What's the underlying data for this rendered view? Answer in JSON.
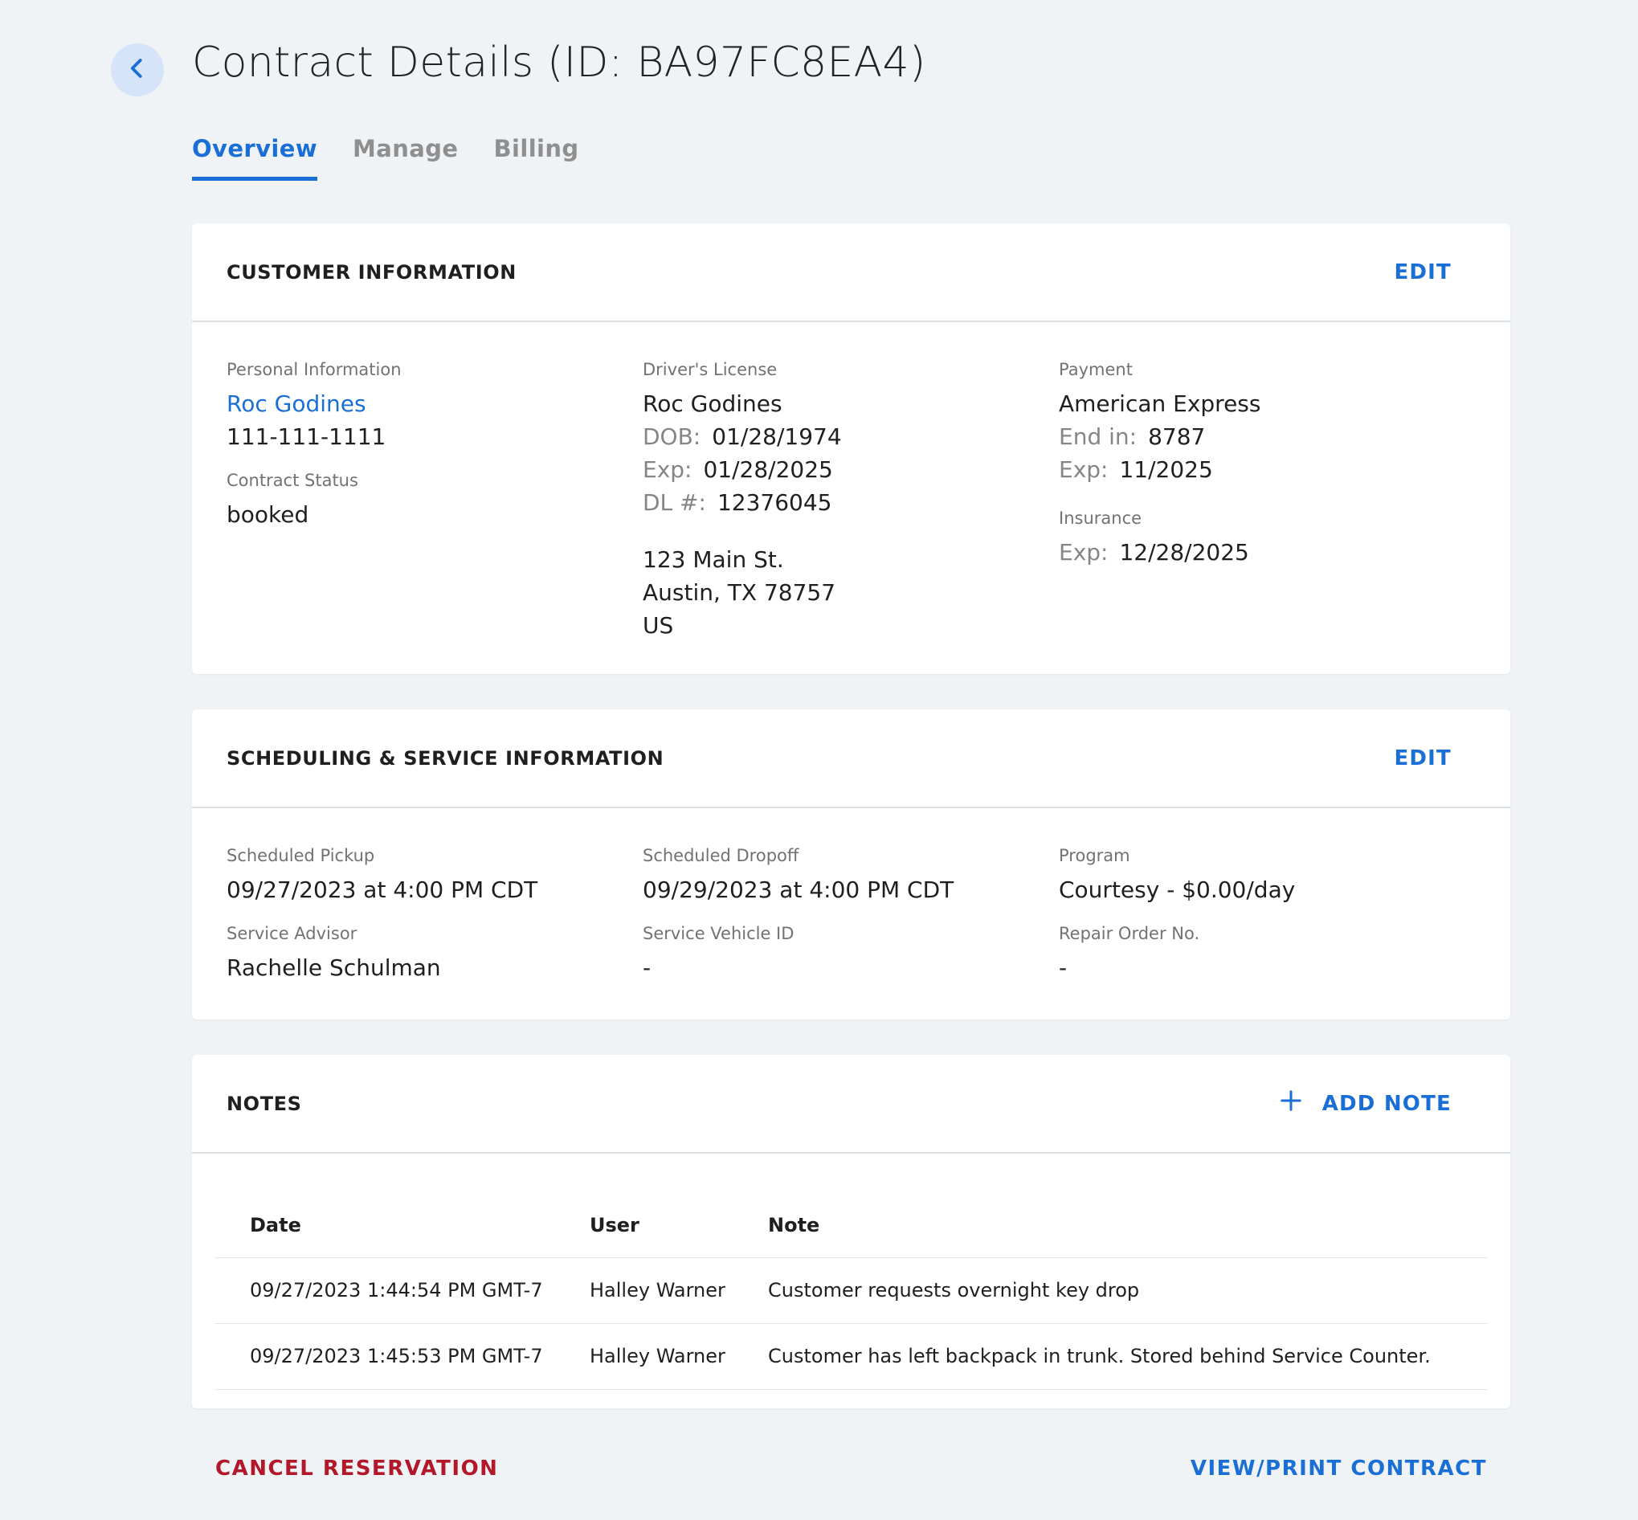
{
  "header": {
    "title": "Contract Details (ID: BA97FC8EA4)"
  },
  "tabs": [
    {
      "label": "Overview"
    },
    {
      "label": "Manage"
    },
    {
      "label": "Billing"
    }
  ],
  "customer": {
    "title": "CUSTOMER INFORMATION",
    "edit_label": "EDIT",
    "personal": {
      "label": "Personal Information",
      "name": "Roc Godines",
      "phone": "111-111-1111"
    },
    "status": {
      "label": "Contract Status",
      "value": "booked"
    },
    "license": {
      "label": "Driver's License",
      "name": "Roc Godines",
      "dob_key": "DOB:",
      "dob": "01/28/1974",
      "exp_key": "Exp:",
      "exp": "01/28/2025",
      "dl_key": "DL #:",
      "dl": "12376045",
      "address_line1": "123 Main St.",
      "address_line2": "Austin, TX 78757",
      "address_line3": "US"
    },
    "payment": {
      "label": "Payment",
      "card": "American Express",
      "end_key": "End in:",
      "end": "8787",
      "exp_key": "Exp:",
      "exp": "11/2025"
    },
    "insurance": {
      "label": "Insurance",
      "exp_key": "Exp:",
      "exp": "12/28/2025"
    }
  },
  "scheduling": {
    "title": "SCHEDULING & SERVICE INFORMATION",
    "edit_label": "EDIT",
    "pickup": {
      "label": "Scheduled Pickup",
      "value": "09/27/2023 at 4:00 PM CDT"
    },
    "dropoff": {
      "label": "Scheduled Dropoff",
      "value": "09/29/2023 at 4:00 PM CDT"
    },
    "program": {
      "label": "Program",
      "value": "Courtesy - $0.00/day"
    },
    "advisor": {
      "label": "Service Advisor",
      "value": "Rachelle Schulman"
    },
    "vehicle": {
      "label": "Service Vehicle ID",
      "value": "-"
    },
    "repair": {
      "label": "Repair Order No.",
      "value": "-"
    }
  },
  "notes": {
    "title": "NOTES",
    "add_label": "ADD NOTE",
    "columns": [
      "Date",
      "User",
      "Note"
    ],
    "rows": [
      [
        "09/27/2023 1:44:54 PM GMT-7",
        "Halley Warner",
        "Customer requests overnight key drop"
      ],
      [
        "09/27/2023 1:45:53 PM GMT-7",
        "Halley Warner",
        "Customer has left backpack in trunk. Stored behind Service Counter."
      ]
    ]
  },
  "footer": {
    "cancel_label": "CANCEL RESERVATION",
    "view_label": "VIEW/PRINT CONTRACT"
  },
  "colors": {
    "accent": "#1a6fd6",
    "danger": "#b3172a",
    "background": "#f0f3f6"
  }
}
